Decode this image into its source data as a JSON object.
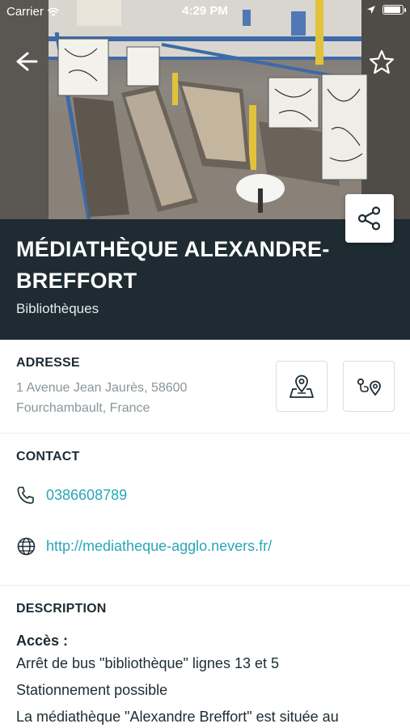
{
  "status_bar": {
    "carrier": "Carrier",
    "time": "4:29 PM"
  },
  "hero": {
    "image_alt": "Photo of the library interior"
  },
  "header": {
    "title": "MÉDIATHÈQUE ALEXANDRE-BREFFORT",
    "category": "Bibliothèques",
    "background_color": "#1e2b33"
  },
  "address_section": {
    "label": "ADRESSE",
    "address": "1 Avenue Jean Jaurès, 58600 Fourchambault, France"
  },
  "contact_section": {
    "label": "CONTACT",
    "phone": "0386608789",
    "website": "http://mediatheque-agglo.nevers.fr/",
    "link_color": "#2aa6b8"
  },
  "description_section": {
    "label": "DESCRIPTION",
    "access_heading": "Accès :",
    "lines": [
      "Arrêt de bus \"bibliothèque\" lignes 13 et 5",
      "Stationnement possible",
      "La médiathèque \"Alexandre Breffort\" est située au"
    ]
  }
}
